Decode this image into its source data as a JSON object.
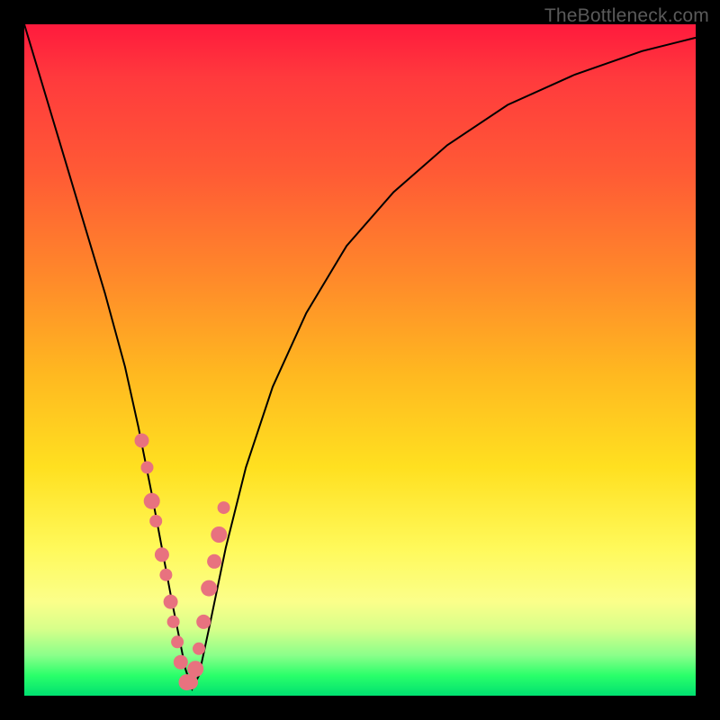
{
  "watermark": "TheBottleneck.com",
  "colors": {
    "dot": "#e8727f",
    "curve": "#000000"
  },
  "chart_data": {
    "type": "line",
    "title": "",
    "xlabel": "",
    "ylabel": "",
    "xlim": [
      0,
      100
    ],
    "ylim": [
      0,
      100
    ],
    "grid": false,
    "series": [
      {
        "name": "bottleneck-curve",
        "x": [
          0,
          3,
          6,
          9,
          12,
          15,
          17,
          19,
          20.5,
          22,
          23.2,
          24,
          25,
          26,
          27.5,
          30,
          33,
          37,
          42,
          48,
          55,
          63,
          72,
          82,
          92,
          100
        ],
        "y": [
          100,
          90,
          80,
          70,
          60,
          49,
          40,
          30,
          22,
          14,
          8,
          4,
          1,
          3,
          10,
          22,
          34,
          46,
          57,
          67,
          75,
          82,
          88,
          92.5,
          96,
          98
        ]
      }
    ],
    "points": {
      "name": "sample-dots",
      "x": [
        17.5,
        18.3,
        19.0,
        19.6,
        20.5,
        21.1,
        21.8,
        22.2,
        22.8,
        23.3,
        24.2,
        24.8,
        25.5,
        26.0,
        26.7,
        27.5,
        28.3,
        29.0,
        29.7
      ],
      "y": [
        38,
        34,
        29,
        26,
        21,
        18,
        14,
        11,
        8,
        5,
        2,
        2,
        4,
        7,
        11,
        16,
        20,
        24,
        28
      ],
      "r": [
        8,
        7,
        9,
        7,
        8,
        7,
        8,
        7,
        7,
        8,
        9,
        8,
        9,
        7,
        8,
        9,
        8,
        9,
        7
      ]
    }
  }
}
